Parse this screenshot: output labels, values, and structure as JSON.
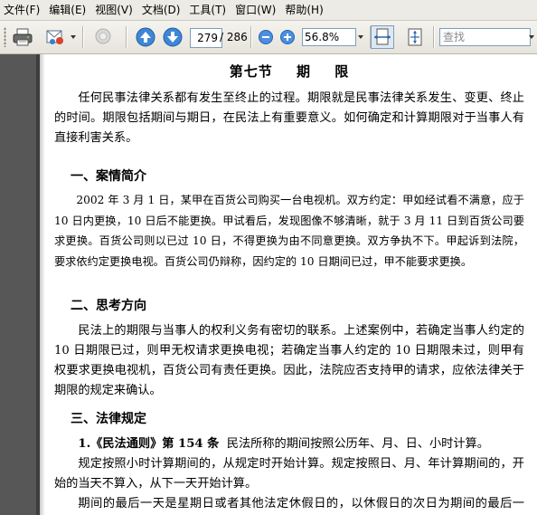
{
  "menubar": {
    "items": [
      "文件(F)",
      "编辑(E)",
      "视图(V)",
      "文档(D)",
      "工具(T)",
      "窗口(W)",
      "帮助(H)"
    ]
  },
  "toolbar": {
    "icons": [
      "printer-icon",
      "email-icon",
      "disabled-search-icon",
      "previous-page-icon",
      "next-page-icon",
      "zoom-out-icon",
      "zoom-in-icon",
      "fit-width-icon",
      "fit-page-icon"
    ],
    "current_page": "279",
    "page_total": "/ 286",
    "zoom": "56.8%",
    "search_placeholder": "查找"
  },
  "document": {
    "section_title": "第七节 期 限",
    "intro": "任何民事法律关系都有发生至终止的过程。期限就是民事法律关系发生、变更、终止的时间。期限包括期间与期日，在民法上有重要意义。如何确定和计算期限对于当事人有直接利害关系。",
    "heading1": "一、案情简介",
    "case_text": "2002 年 3 月 1 日，某甲在百货公司购买一台电视机。双方约定：甲如经试看不满意，应于 10 日内更换，10 日后不能更换。甲试看后，发现图像不够清晰，就于 3 月 11 日到百货公司要求更换。百货公司则以已过 10 日，不得更换为由不同意更换。双方争执不下。甲起诉到法院，要求依约定更换电视。百货公司仍辩称，因约定的 10 日期间已过，甲不能要求更换。",
    "heading2": "二、思考方向",
    "thinking_text": "民法上的期限与当事人的权利义务有密切的联系。上述案例中，若确定当事人约定的 10 日期限已过，则甲无权请求更换电视；若确定当事人约定的 10 日期限未过，则甲有权要求更换电视机，百货公司有责任更换。因此，法院应否支持甲的请求，应依法律关于期限的规定来确认。",
    "heading3": "三、法律规定",
    "law_title": "1.《民法通则》第 154 条",
    "law_line1": "民法所称的期间按照公历年、月、日、小时计算。",
    "law_para2": "规定按照小时计算期间的，从规定时开始计算。规定按照日、月、年计算期间的，开始的当天不算入，从下一天开始计算。",
    "law_para3": "期间的最后一天是星期日或者其他法定休假日的，以休假日的次日为期间的最后一天。"
  },
  "colors": {
    "menubar_bg": "#ecebe6",
    "nav_pane": "#575757",
    "page_bg": "#ffffff"
  }
}
